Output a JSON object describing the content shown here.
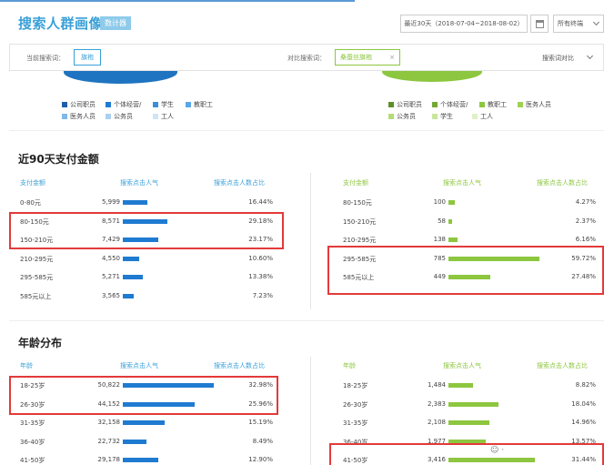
{
  "header": {
    "title": "搜索人群画像",
    "tag": "数计器",
    "date_range": "最近30天（2018-07-04~2018-08-02）",
    "terminal": "所有终端"
  },
  "searchbar": {
    "current_label": "当前搜索词：",
    "current_keyword": "旗袍",
    "compare_label": "对比搜索词：",
    "compare_keyword": "桑蚕丝旗袍",
    "compare_toggle": "搜索词对比"
  },
  "legend_left": [
    "公司职员",
    "个体经营/",
    "学生",
    "教职工",
    "医务人员",
    "公务员",
    "工人"
  ],
  "legend_right": [
    "公司职员",
    "个体经营/",
    "教职工",
    "医务人员",
    "公务员",
    "学生",
    "工人"
  ],
  "colors": {
    "blue": "#1f7bd1",
    "green": "#8dc63f",
    "accent": "#3aa0d8",
    "highlight": "#e33a3a",
    "legend_left": [
      "#1f5fa8",
      "#1f7bd1",
      "#3a8fd8",
      "#5aa7e8",
      "#7fb9ea",
      "#a9d0f0",
      "#cfe4f6"
    ],
    "legend_right": [
      "#5e8e2a",
      "#74a933",
      "#8dc63f",
      "#9fd152",
      "#b4dc78",
      "#c8e69c",
      "#e0f0c8"
    ]
  },
  "pay": {
    "title": "近90天支付金额",
    "headers": [
      "支付金额",
      "搜索点击人气",
      "搜索点击人数占比"
    ],
    "left": [
      {
        "label": "0-80元",
        "value": "5,999",
        "pct": "16.44%",
        "share": 16.44
      },
      {
        "label": "80-150元",
        "value": "8,571",
        "pct": "29.18%",
        "share": 29.18
      },
      {
        "label": "150-210元",
        "value": "7,429",
        "pct": "23.17%",
        "share": 23.17
      },
      {
        "label": "210-295元",
        "value": "4,550",
        "pct": "10.60%",
        "share": 10.6
      },
      {
        "label": "295-585元",
        "value": "5,271",
        "pct": "13.38%",
        "share": 13.38
      },
      {
        "label": "585元以上",
        "value": "3,565",
        "pct": "7.23%",
        "share": 7.23
      }
    ],
    "right": [
      {
        "label": "80-150元",
        "value": "100",
        "pct": "4.27%",
        "share": 4.27
      },
      {
        "label": "150-210元",
        "value": "58",
        "pct": "2.37%",
        "share": 2.37
      },
      {
        "label": "210-295元",
        "value": "138",
        "pct": "6.16%",
        "share": 6.16
      },
      {
        "label": "295-585元",
        "value": "785",
        "pct": "59.72%",
        "share": 59.72
      },
      {
        "label": "585元以上",
        "value": "449",
        "pct": "27.48%",
        "share": 27.48
      }
    ]
  },
  "age": {
    "title": "年龄分布",
    "headers": [
      "年龄",
      "搜索点击人气",
      "搜索点击人数占比"
    ],
    "left": [
      {
        "label": "18-25岁",
        "value": "50,822",
        "pct": "32.98%",
        "share": 32.98
      },
      {
        "label": "26-30岁",
        "value": "44,152",
        "pct": "25.96%",
        "share": 25.96
      },
      {
        "label": "31-35岁",
        "value": "32,158",
        "pct": "15.19%",
        "share": 15.19
      },
      {
        "label": "36-40岁",
        "value": "22,732",
        "pct": "8.49%",
        "share": 8.49
      },
      {
        "label": "41-50岁",
        "value": "29,178",
        "pct": "12.90%",
        "share": 12.9
      }
    ],
    "right": [
      {
        "label": "18-25岁",
        "value": "1,484",
        "pct": "8.82%",
        "share": 8.82
      },
      {
        "label": "26-30岁",
        "value": "2,383",
        "pct": "18.04%",
        "share": 18.04
      },
      {
        "label": "31-35岁",
        "value": "2,108",
        "pct": "14.96%",
        "share": 14.96
      },
      {
        "label": "36-40岁",
        "value": "1,977",
        "pct": "13.57%",
        "share": 13.57
      },
      {
        "label": "41-50岁",
        "value": "3,416",
        "pct": "31.44%",
        "share": 31.44
      }
    ]
  }
}
